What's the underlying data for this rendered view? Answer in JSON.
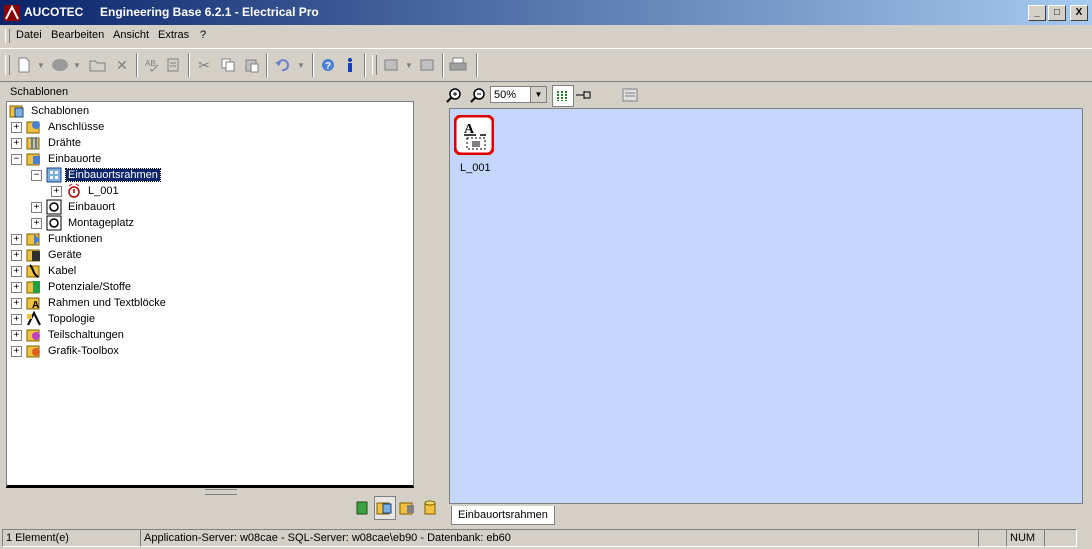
{
  "window": {
    "title": "AUCOTEC     Engineering Base 6.2.1 - Electrical Pro",
    "controls": [
      "_",
      "□",
      "X"
    ]
  },
  "menu": {
    "items": [
      {
        "label": "Datei"
      },
      {
        "label": "Bearbeiten"
      },
      {
        "label": "Ansicht"
      },
      {
        "label": "Extras"
      },
      {
        "label": "?"
      }
    ]
  },
  "left_pane": {
    "header": "Schablonen",
    "tree": [
      {
        "label": "Schablonen",
        "expander": "",
        "level": 0,
        "icon": "folder-root-icon"
      },
      {
        "label": "Anschlüsse",
        "expander": "+",
        "level": 1,
        "icon": "connector-folder-icon"
      },
      {
        "label": "Drähte",
        "expander": "+",
        "level": 1,
        "icon": "wire-folder-icon"
      },
      {
        "label": "Einbauorte",
        "expander": "−",
        "level": 1,
        "icon": "location-folder-icon"
      },
      {
        "label": "Einbauortsrahmen",
        "expander": "−",
        "level": 2,
        "icon": "frame-icon",
        "selected": true
      },
      {
        "label": "L_001",
        "expander": "+",
        "level": 3,
        "icon": "location-item-icon"
      },
      {
        "label": "Einbauort",
        "expander": "+",
        "level": 2,
        "icon": "location-icon"
      },
      {
        "label": "Montageplatz",
        "expander": "+",
        "level": 2,
        "icon": "mounting-icon"
      },
      {
        "label": "Funktionen",
        "expander": "+",
        "level": 1,
        "icon": "function-folder-icon"
      },
      {
        "label": "Geräte",
        "expander": "+",
        "level": 1,
        "icon": "device-folder-icon"
      },
      {
        "label": "Kabel",
        "expander": "+",
        "level": 1,
        "icon": "cable-folder-icon"
      },
      {
        "label": "Potenziale/Stoffe",
        "expander": "+",
        "level": 1,
        "icon": "potential-folder-icon"
      },
      {
        "label": "Rahmen und Textblöcke",
        "expander": "+",
        "level": 1,
        "icon": "frame-folder-icon"
      },
      {
        "label": "Topologie",
        "expander": "+",
        "level": 1,
        "icon": "topology-icon"
      },
      {
        "label": "Teilschaltungen",
        "expander": "+",
        "level": 1,
        "icon": "subcircuit-folder-icon"
      },
      {
        "label": "Grafik-Toolbox",
        "expander": "+",
        "level": 1,
        "icon": "graphic-folder-icon"
      }
    ]
  },
  "right_pane": {
    "zoom_value": "50%",
    "items": [
      {
        "label": "L_001",
        "icon": "location-frame-template-icon"
      }
    ],
    "tab": "Einbauortsrahmen"
  },
  "status": {
    "count": "1 Element(e)",
    "server": "Application-Server: w08cae - SQL-Server: w08cae\\eb90 - Datenbank: eb60",
    "num": "NUM"
  },
  "colors": {
    "titlebar_start": "#0a246a",
    "titlebar_end": "#a6caf0",
    "canvas": "#c4d6fb",
    "selection": "#0a246a",
    "highlight": "#e00000"
  }
}
